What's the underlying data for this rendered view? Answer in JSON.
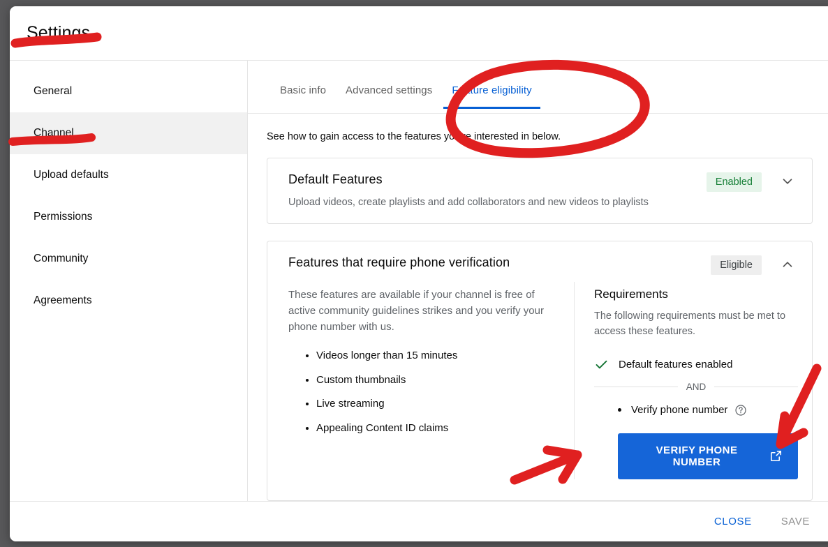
{
  "dialog": {
    "title": "Settings"
  },
  "sidebar": {
    "items": [
      {
        "label": "General",
        "selected": false
      },
      {
        "label": "Channel",
        "selected": true
      },
      {
        "label": "Upload defaults",
        "selected": false
      },
      {
        "label": "Permissions",
        "selected": false
      },
      {
        "label": "Community",
        "selected": false
      },
      {
        "label": "Agreements",
        "selected": false
      }
    ]
  },
  "main": {
    "tabs": [
      {
        "label": "Basic info",
        "active": false
      },
      {
        "label": "Advanced settings",
        "active": false
      },
      {
        "label": "Feature eligibility",
        "active": true
      }
    ],
    "intro": "See how to gain access to the features you're interested in below.",
    "cards": [
      {
        "title": "Default Features",
        "badge": "Enabled",
        "badge_state": "enabled",
        "subtitle": "Upload videos, create playlists and add collaborators and new videos to playlists",
        "expanded": false,
        "chevron": "chevron-down-icon"
      },
      {
        "title": "Features that require phone verification",
        "badge": "Eligible",
        "badge_state": "eligible",
        "expanded": true,
        "chevron": "chevron-up-icon",
        "description": "These features are available if your channel is free of active community guidelines strikes and you verify your phone number with us.",
        "features": [
          "Videos longer than 15 minutes",
          "Custom thumbnails",
          "Live streaming",
          "Appealing Content ID claims"
        ],
        "requirements": {
          "heading": "Requirements",
          "subtitle": "The following requirements must be met to access these features.",
          "met_item": "Default features enabled",
          "operator": "AND",
          "todo_item": "Verify phone number",
          "help_icon": "help-circle-icon",
          "action_label": "VERIFY PHONE NUMBER",
          "action_icon": "external-link-icon"
        }
      }
    ]
  },
  "footer": {
    "close_label": "CLOSE",
    "save_label": "SAVE"
  },
  "annotations": {
    "marker_color": "#e02020",
    "items": [
      {
        "name": "settings-underline",
        "type": "underline",
        "target": "Settings"
      },
      {
        "name": "channel-underline",
        "type": "underline",
        "target": "Channel"
      },
      {
        "name": "feature-eligibility-circle",
        "type": "ellipse",
        "target": "Feature eligibility"
      },
      {
        "name": "verify-button-arrow-left",
        "type": "arrow",
        "target": "VERIFY PHONE NUMBER"
      },
      {
        "name": "verify-button-arrow-right",
        "type": "arrow",
        "target": "VERIFY PHONE NUMBER"
      }
    ]
  },
  "colors": {
    "accent_blue": "#065fd4",
    "button_blue": "#1565d8",
    "enabled_green_text": "#188038",
    "enabled_green_bg": "#e6f4ea",
    "eligible_gray_bg": "#eeeeee",
    "marker_red": "#e02020",
    "backdrop": "#58585a"
  }
}
